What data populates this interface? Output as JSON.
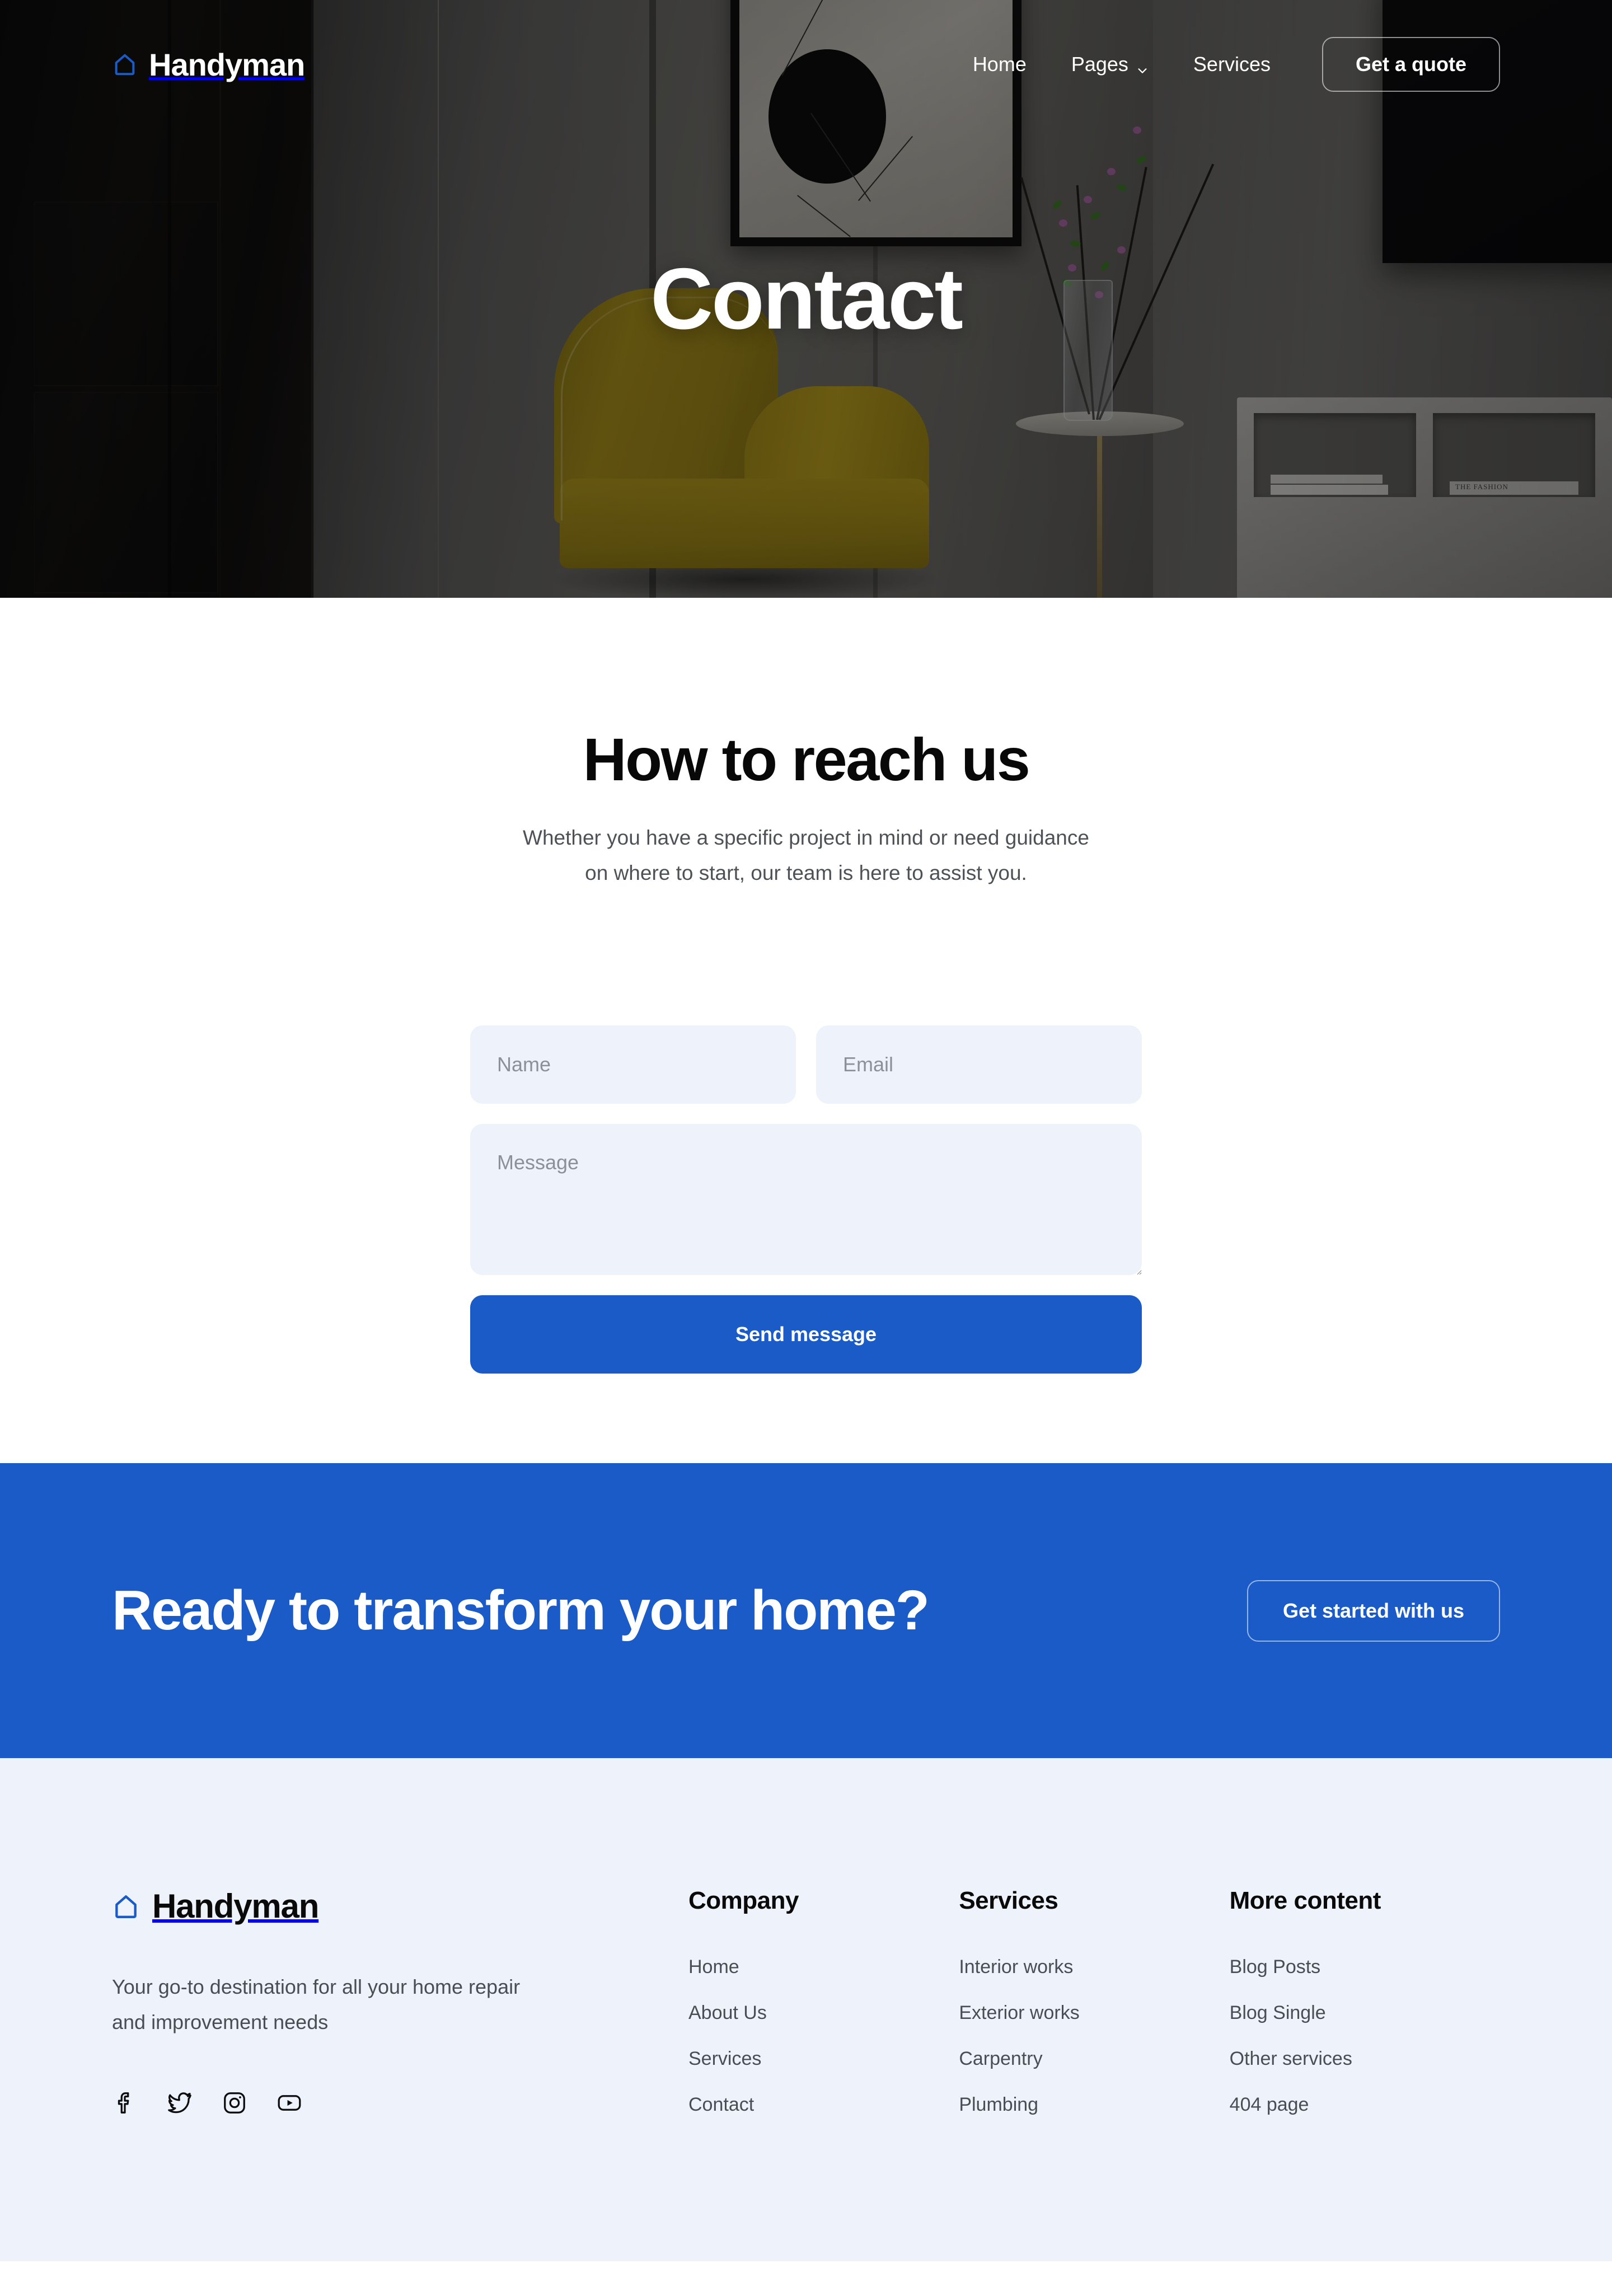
{
  "brand": {
    "name": "Handyman",
    "icon": "home-outline-icon",
    "accent": "#1a5bc8"
  },
  "nav": {
    "links": [
      {
        "label": "Home",
        "has_chevron": false
      },
      {
        "label": "Pages",
        "has_chevron": true
      },
      {
        "label": "Services",
        "has_chevron": false
      }
    ],
    "cta_label": "Get a quote"
  },
  "hero": {
    "title": "Contact"
  },
  "reach": {
    "title": "How to reach us",
    "subtitle_line1": "Whether you have a specific project in mind or need guidance",
    "subtitle_line2": "on where to start, our team is here to assist you."
  },
  "form": {
    "name_placeholder": "Name",
    "name_value": "",
    "email_placeholder": "Email",
    "email_value": "",
    "message_placeholder": "Message",
    "message_value": "",
    "submit_label": "Send message"
  },
  "cta": {
    "title": "Ready to transform your home?",
    "button_label": "Get started with us",
    "background": "#1a5bc8"
  },
  "footer": {
    "brand_name": "Handyman",
    "tagline": "Your go-to destination for all your home repair and improvement needs",
    "socials": [
      {
        "name": "facebook-icon"
      },
      {
        "name": "twitter-icon"
      },
      {
        "name": "instagram-icon"
      },
      {
        "name": "youtube-icon"
      }
    ],
    "columns": [
      {
        "title": "Company",
        "links": [
          "Home",
          "About Us",
          "Services",
          "Contact"
        ]
      },
      {
        "title": "Services",
        "links": [
          "Interior works",
          "Exterior works",
          "Carpentry",
          "Plumbing"
        ]
      },
      {
        "title": "More content",
        "links": [
          "Blog Posts",
          "Blog Single",
          "Other services",
          "404 page"
        ]
      }
    ]
  }
}
